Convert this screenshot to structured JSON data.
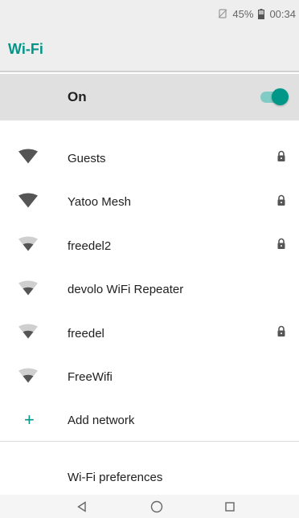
{
  "status_bar": {
    "battery_percent": "45%",
    "time": "00:34"
  },
  "app_bar": {
    "title": "Wi-Fi"
  },
  "master_switch": {
    "label": "On",
    "state": true,
    "accent_color": "#009688"
  },
  "networks": [
    {
      "name": "Guests",
      "signal": "full",
      "locked": true
    },
    {
      "name": "Yatoo Mesh",
      "signal": "full",
      "locked": true
    },
    {
      "name": "freedel2",
      "signal": "weak",
      "locked": true
    },
    {
      "name": "devolo WiFi Repeater",
      "signal": "weak",
      "locked": false
    },
    {
      "name": "freedel",
      "signal": "weak",
      "locked": true
    },
    {
      "name": "FreeWifi",
      "signal": "weak",
      "locked": false
    }
  ],
  "add_network": {
    "label": "Add network",
    "icon": "plus-icon"
  },
  "preferences": {
    "label": "Wi-Fi preferences"
  },
  "nav_bar": {
    "icons": [
      "back-icon",
      "home-icon",
      "recents-icon"
    ]
  }
}
